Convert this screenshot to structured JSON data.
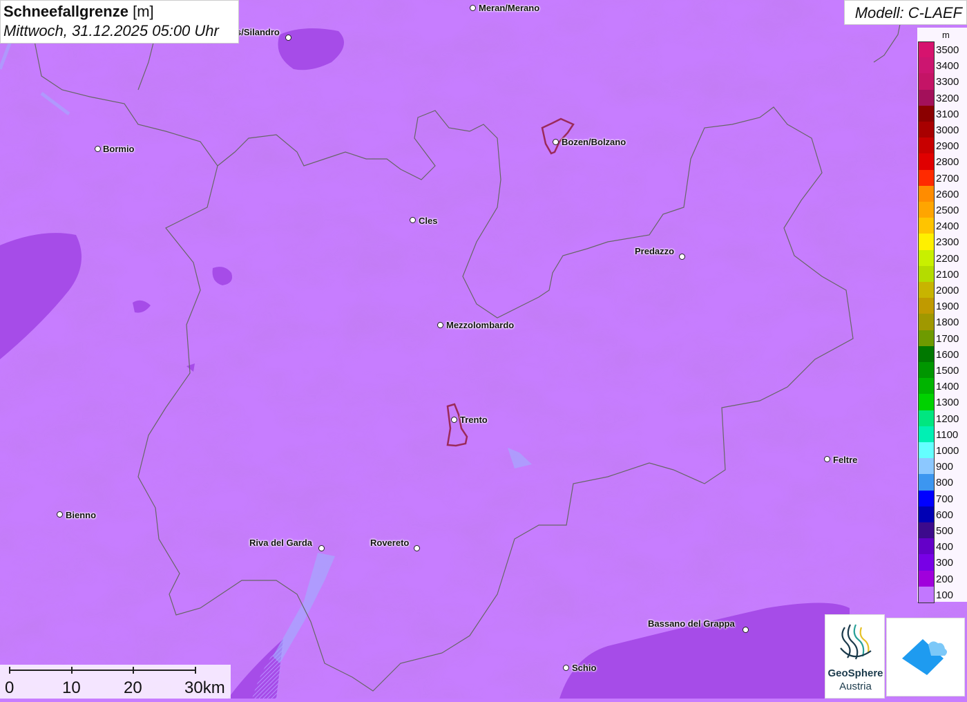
{
  "title": {
    "parameter": "Schneefallgrenze",
    "unit": "[m]",
    "datetime": "Mittwoch, 31.12.2025 05:00 Uhr"
  },
  "model_label": "Modell: C-LAEF",
  "legend": {
    "unit": "m",
    "entries": [
      {
        "value": "3500",
        "color": "#d6136e"
      },
      {
        "value": "3400",
        "color": "#cc1570"
      },
      {
        "value": "3300",
        "color": "#c41466"
      },
      {
        "value": "3200",
        "color": "#a3105a"
      },
      {
        "value": "3100",
        "color": "#8b0000"
      },
      {
        "value": "3000",
        "color": "#a80000"
      },
      {
        "value": "2900",
        "color": "#c80000"
      },
      {
        "value": "2800",
        "color": "#e00000"
      },
      {
        "value": "2700",
        "color": "#ff2a00"
      },
      {
        "value": "2600",
        "color": "#ff8c00"
      },
      {
        "value": "2500",
        "color": "#ffa500"
      },
      {
        "value": "2400",
        "color": "#ffc400"
      },
      {
        "value": "2300",
        "color": "#fff000"
      },
      {
        "value": "2200",
        "color": "#c8f000"
      },
      {
        "value": "2100",
        "color": "#b4dc00"
      },
      {
        "value": "2000",
        "color": "#c8b400"
      },
      {
        "value": "1900",
        "color": "#c09a00"
      },
      {
        "value": "1800",
        "color": "#a09800"
      },
      {
        "value": "1700",
        "color": "#6e9a00"
      },
      {
        "value": "1600",
        "color": "#007800"
      },
      {
        "value": "1500",
        "color": "#009600"
      },
      {
        "value": "1400",
        "color": "#00b400"
      },
      {
        "value": "1300",
        "color": "#00d200"
      },
      {
        "value": "1200",
        "color": "#00e680"
      },
      {
        "value": "1100",
        "color": "#00f0b4"
      },
      {
        "value": "1000",
        "color": "#64ffff"
      },
      {
        "value": "900",
        "color": "#8cc8ff"
      },
      {
        "value": "800",
        "color": "#3c96f0"
      },
      {
        "value": "700",
        "color": "#0000ff"
      },
      {
        "value": "600",
        "color": "#0000b4"
      },
      {
        "value": "500",
        "color": "#3c0a8c"
      },
      {
        "value": "400",
        "color": "#6400c8"
      },
      {
        "value": "300",
        "color": "#7800e6"
      },
      {
        "value": "200",
        "color": "#a000dc"
      },
      {
        "value": "100",
        "color": "#c277ff"
      }
    ]
  },
  "cities": [
    {
      "name": "Meran/Merano"
    },
    {
      "name": "s/Silandro"
    },
    {
      "name": "Bormio"
    },
    {
      "name": "Bozen/Bolzano"
    },
    {
      "name": "Cles"
    },
    {
      "name": "Predazzo"
    },
    {
      "name": "Mezzolombardo"
    },
    {
      "name": "Trento"
    },
    {
      "name": "Feltre"
    },
    {
      "name": "Bienno"
    },
    {
      "name": "Riva del Garda"
    },
    {
      "name": "Rovereto"
    },
    {
      "name": "Bassano del Grappa"
    },
    {
      "name": "Schio"
    }
  ],
  "scale_bar": {
    "labels": [
      "0",
      "10",
      "20",
      "30km"
    ]
  },
  "logos": {
    "geosphere_name": "GeoSphere",
    "geosphere_sub": "Austria"
  },
  "colors": {
    "map_background": "#c77dff",
    "dark_zone": "#a64ce8",
    "medium_zone": "#b05cf0",
    "border_line": "#666666",
    "city_outline": "#9b2a5a",
    "water": "#9cb4ff"
  }
}
